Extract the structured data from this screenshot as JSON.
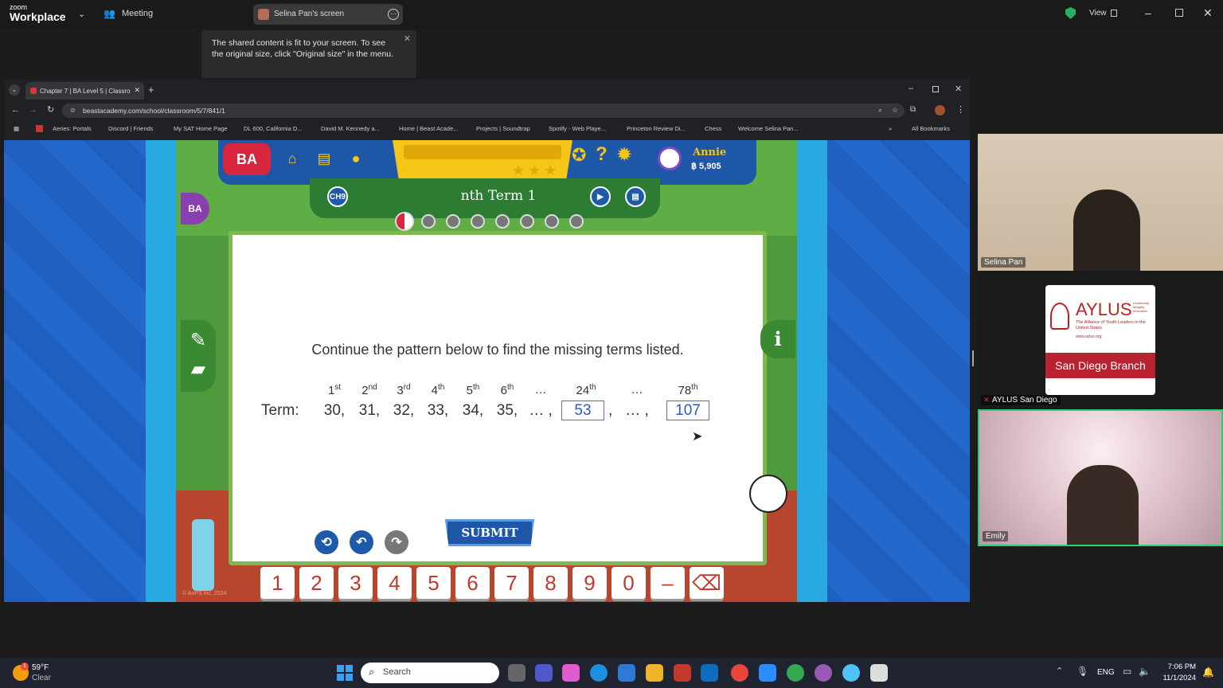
{
  "zoom": {
    "logo_small": "zoom",
    "logo_big": "Workplace",
    "meeting_label": "Meeting",
    "share_label": "Selina Pan's screen",
    "view_label": "View",
    "tooltip_text": "The shared content is fit to your screen. To see the original size, click \"Original size\" in the menu."
  },
  "browser": {
    "tab_title": "Chapter 7 | BA Level 5 | Classro",
    "url": "beastacademy.com/school/classroom/5/7/841/1",
    "bookmarks": [
      "Aeries: Portals",
      "Discord | Friends",
      "My SAT Home Page",
      "DL 600, California D...",
      "David M. Kennedy a...",
      "Home | Beast Acade...",
      "Projects | Soundtrap",
      "Spotify - Web Playe...",
      "Princeton Review Di...",
      "Chess",
      "Welcome Selina Pan..."
    ],
    "all_bookmarks": "All Bookmarks"
  },
  "game": {
    "user_name": "Annie",
    "coins": "฿ 5,905",
    "chapter": "CH9",
    "lesson_title": "nth Term 1",
    "prompt": "Continue the pattern below to find the missing terms listed.",
    "term_label": "Term:",
    "ordinals": [
      {
        "n": "1",
        "suf": "st"
      },
      {
        "n": "2",
        "suf": "nd"
      },
      {
        "n": "3",
        "suf": "rd"
      },
      {
        "n": "4",
        "suf": "th"
      },
      {
        "n": "5",
        "suf": "th"
      },
      {
        "n": "6",
        "suf": "th"
      },
      {
        "n": "…",
        "suf": ""
      },
      {
        "n": "24",
        "suf": "th"
      },
      {
        "n": "…",
        "suf": ""
      },
      {
        "n": "78",
        "suf": "th"
      }
    ],
    "terms": [
      "30,",
      "31,",
      "32,",
      "33,",
      "34,",
      "35,",
      "… ,",
      "",
      ",",
      "… ,"
    ],
    "answer_24": "53",
    "answer_78": "107",
    "submit": "SUBMIT",
    "keys": [
      "1",
      "2",
      "3",
      "4",
      "5",
      "6",
      "7",
      "8",
      "9",
      "0",
      "–",
      "⌫"
    ],
    "copyright": "© AoPS Inc. 2024",
    "logo_text": "BA"
  },
  "participants": [
    {
      "name": "Selina Pan"
    },
    {
      "name": "AYLUS San Diego",
      "org_title": "AYLUS",
      "org_tag1": "Leadership",
      "org_tag2": "Integrity",
      "org_tag3": "Innovation",
      "org_sub": "The Alliance of Youth Leaders in the United States",
      "org_url": "www.aylus.org",
      "branch": "San Diego Branch"
    },
    {
      "name": "Emily"
    }
  ],
  "taskbar": {
    "temp": "59°F",
    "weather": "Clear",
    "weather_badge": "1",
    "search_placeholder": "Search",
    "lang": "ENG",
    "time": "7:06 PM",
    "date": "11/1/2024"
  },
  "colors": {
    "accent_blue": "#1e62c6",
    "zoom_green": "#27ae60",
    "key_red": "#c0392b"
  }
}
